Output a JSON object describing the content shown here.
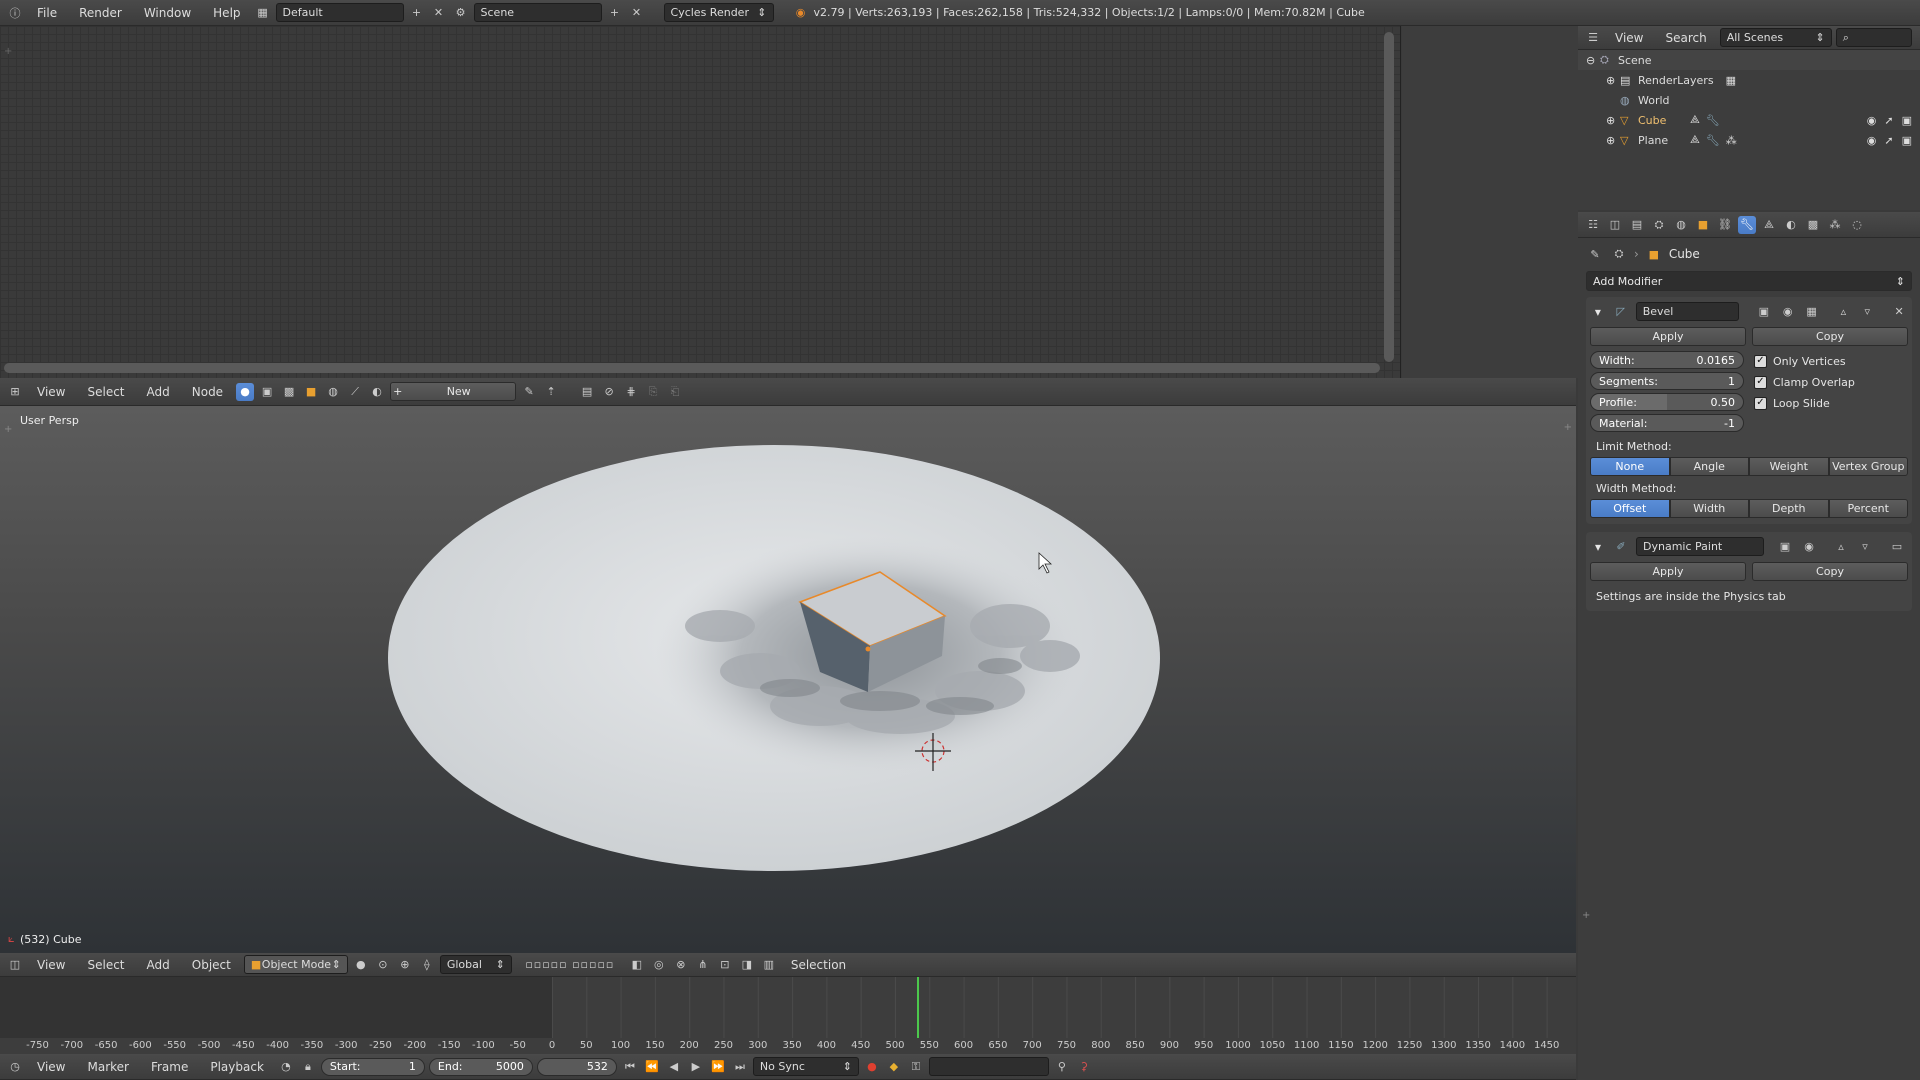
{
  "top_bar": {
    "menus": [
      "File",
      "Render",
      "Window",
      "Help"
    ],
    "layout": "Default",
    "scene": "Scene",
    "engine": "Cycles Render",
    "stats": "v2.79 | Verts:263,193 | Faces:262,158 | Tris:524,332 | Objects:1/2 | Lamps:0/0 | Mem:70.82M | Cube"
  },
  "node_header": {
    "menus": [
      "View",
      "Select",
      "Add",
      "Node"
    ],
    "new_label": "New"
  },
  "viewport": {
    "view_label": "User Persp",
    "object_label": "(532) Cube"
  },
  "view3d_header": {
    "menus": [
      "View",
      "Select",
      "Add",
      "Object"
    ],
    "mode": "Object Mode",
    "orientation": "Global",
    "selection": "Selection"
  },
  "timeline": {
    "ticks": [
      -750,
      -700,
      -650,
      -600,
      -550,
      -500,
      -450,
      -400,
      -350,
      -300,
      -250,
      -200,
      -150,
      -100,
      -50,
      0,
      50,
      100,
      150,
      200,
      250,
      300,
      350,
      400,
      450,
      500,
      550,
      600,
      650,
      700,
      750,
      800,
      850,
      900,
      950,
      1000,
      1050,
      1100,
      1150,
      1200,
      1250,
      1300,
      1350,
      1400,
      1450
    ],
    "current_frame": 532,
    "menus": [
      "View",
      "Marker",
      "Frame",
      "Playback"
    ],
    "start_label": "Start:",
    "start": "1",
    "end_label": "End:",
    "end": "5000",
    "frame": "532",
    "sync": "No Sync"
  },
  "outliner": {
    "menus": [
      "View",
      "Search"
    ],
    "filter": "All Scenes",
    "items": [
      {
        "label": "Scene",
        "indent": 0
      },
      {
        "label": "RenderLayers",
        "indent": 1
      },
      {
        "label": "World",
        "indent": 1
      },
      {
        "label": "Cube",
        "indent": 1
      },
      {
        "label": "Plane",
        "indent": 1
      }
    ]
  },
  "properties": {
    "object": "Cube",
    "add_modifier": "Add Modifier",
    "bevel": {
      "name": "Bevel",
      "apply": "Apply",
      "copy": "Copy",
      "width_label": "Width:",
      "width": "0.0165",
      "segments_label": "Segments:",
      "segments": "1",
      "profile_label": "Profile:",
      "profile": "0.50",
      "material_label": "Material:",
      "material": "-1",
      "only_vertices": "Only Vertices",
      "clamp_overlap": "Clamp Overlap",
      "loop_slide": "Loop Slide",
      "limit_method_label": "Limit Method:",
      "limit_methods": [
        "None",
        "Angle",
        "Weight",
        "Vertex Group"
      ],
      "width_method_label": "Width Method:",
      "width_methods": [
        "Offset",
        "Width",
        "Depth",
        "Percent"
      ]
    },
    "dynamic_paint": {
      "name": "Dynamic Paint",
      "apply": "Apply",
      "copy": "Copy",
      "note": "Settings are inside the Physics tab"
    }
  }
}
